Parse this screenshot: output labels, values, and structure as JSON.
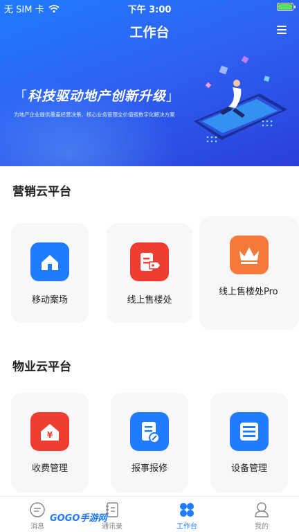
{
  "status_bar": {
    "carrier": "无 SIM 卡",
    "time": "下午 3:00",
    "battery_level": 0.9
  },
  "header": {
    "title": "工作台",
    "menu_icon": "hamburger-menu-icon"
  },
  "banner": {
    "headline": "科技驱动地产创新升级",
    "subtitle": "为地产企业提供覆盖经营决策、核心业务管理全价值链数字化解决方案"
  },
  "sections": [
    {
      "title": "营销云平台",
      "items": [
        {
          "label": "移动案场",
          "icon": "home-icon"
        },
        {
          "label": "线上售楼处",
          "icon": "document-tag-icon"
        },
        {
          "label": "线上售楼处Pro",
          "icon": "crown-icon"
        }
      ]
    },
    {
      "title": "物业云平台",
      "items": [
        {
          "label": "收费管理",
          "icon": "yuan-house-icon"
        },
        {
          "label": "报事报修",
          "icon": "repair-document-icon"
        },
        {
          "label": "设备管理",
          "icon": "device-list-icon"
        }
      ]
    }
  ],
  "tabbar": {
    "items": [
      {
        "label": "消息",
        "icon": "message-icon"
      },
      {
        "label": "通讯录",
        "icon": "contacts-icon"
      },
      {
        "label": "工作台",
        "icon": "workbench-icon",
        "active": true
      },
      {
        "label": "我的",
        "icon": "profile-icon"
      }
    ]
  },
  "watermark": "GOGO手游网",
  "colors": {
    "primary": "#1f7bff",
    "red": "#ef3d2f",
    "orange": "#f57a3a"
  }
}
